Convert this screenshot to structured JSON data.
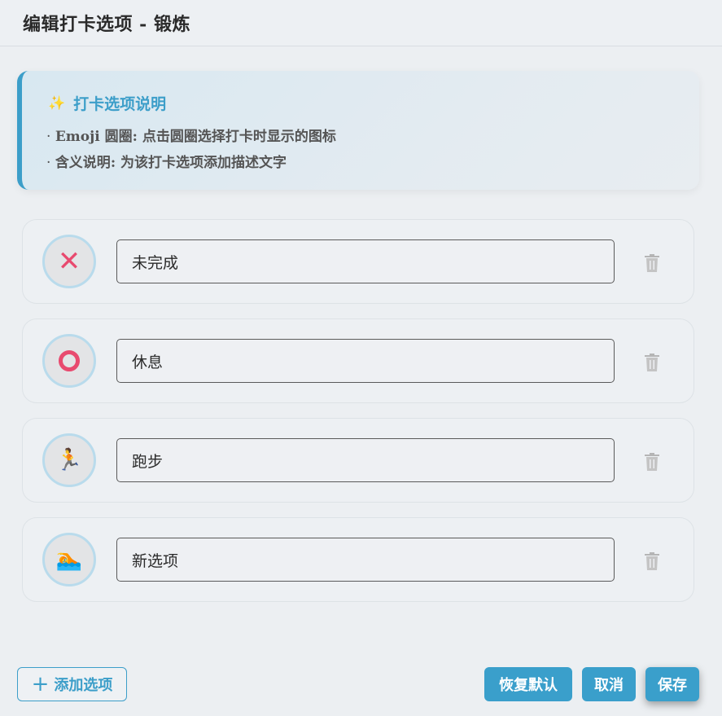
{
  "header": {
    "title": "编辑打卡选项 - 锻炼"
  },
  "info": {
    "icon": "sparkle-icon",
    "title": "打卡选项说明",
    "lines": [
      {
        "key": "Emoji 圆圈",
        "text": ": 点击圆圈选择打卡时显示的图标",
        "bullet": "·"
      },
      {
        "key": "含义说明",
        "text": ": 为该打卡选项添加描述文字",
        "bullet": "·"
      }
    ]
  },
  "options": [
    {
      "emoji": "x-mark-icon",
      "glyph": "✕",
      "value": "未完成"
    },
    {
      "emoji": "circle-icon",
      "glyph": "",
      "value": "休息"
    },
    {
      "emoji": "running-person-icon",
      "glyph": "🏃",
      "value": "跑步"
    },
    {
      "emoji": "swimmer-icon",
      "glyph": "🏊",
      "value": "新选项"
    }
  ],
  "footer": {
    "add_label": "添加选项",
    "restore_label": "恢复默认",
    "cancel_label": "取消",
    "save_label": "保存"
  },
  "colors": {
    "accent": "#3c9ec9",
    "delete_icon": "#b5b5b5",
    "emoji_red": "#e84a6f"
  }
}
